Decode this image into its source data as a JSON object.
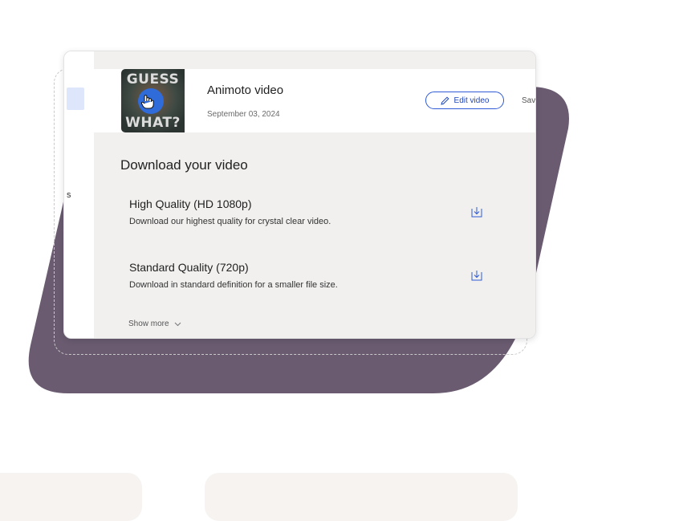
{
  "video": {
    "title": "Animoto video",
    "date": "September 03, 2024",
    "thumbnail_text_top": "GUESS",
    "thumbnail_text_bottom": "WHAT?"
  },
  "actions": {
    "edit_label": "Edit video",
    "save_label": "Sav"
  },
  "sidebar": {
    "partial_text": "s"
  },
  "download": {
    "heading": "Download your video",
    "options": [
      {
        "title": "High Quality (HD 1080p)",
        "description": "Download our highest quality for crystal clear video."
      },
      {
        "title": "Standard Quality (720p)",
        "description": "Download in standard definition for a smaller file size."
      }
    ],
    "show_more_label": "Show more"
  },
  "colors": {
    "accent": "#2f5bd6",
    "backdrop": "#6a5b70",
    "panel": "#f1f0ef"
  },
  "icons": [
    "pencil-icon",
    "download-icon",
    "chevron-down-icon",
    "hand-cursor-icon"
  ]
}
